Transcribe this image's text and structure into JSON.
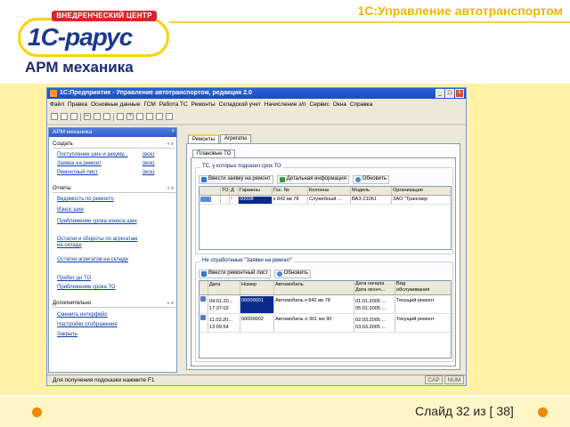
{
  "slide": {
    "logo_banner": "ВНЕДРЕНЧЕСКИЙ ЦЕНТР",
    "logo_word": "1С-рарус",
    "product_title": "1С:Управление автотранспортом",
    "heading": "АРМ механика",
    "slide_number": "Слайд 32 из [ 38]",
    "accent_color": "#f08a00"
  },
  "window": {
    "title": "1С:Предприятие - Управление автотранспортом, редакция 2.0",
    "menu": [
      "Файл",
      "Правка",
      "Основные данные",
      "ГСМ",
      "Работа ТС",
      "Ремонты",
      "Складской учет",
      "Начисление з/п",
      "Сервис",
      "Окна",
      "Справка"
    ],
    "statusbar": {
      "hint": "Для получения подсказки нажмите F1",
      "cap": "CAP",
      "num": "NUM"
    }
  },
  "left_panel": {
    "title": "АРМ механика",
    "sections": [
      {
        "title": "Создать",
        "items": [
          {
            "label": "Поступление шин и аккуму...",
            "all": "(все)"
          },
          {
            "label": "Заявка на ремонт",
            "all": "(все)"
          },
          {
            "label": "Ремонтный лист",
            "all": "(все)"
          }
        ]
      },
      {
        "title": "Отчеты",
        "items": [
          {
            "label": "Ведомость по ремонту"
          },
          {
            "label": "Износ шин"
          },
          {
            "label": "Приближение срока износа шин"
          },
          {
            "label": "Остатки и обороты по агрегатам на складе"
          },
          {
            "label": "Остатки агрегатов на складе"
          },
          {
            "label": "Пробег до ТО"
          },
          {
            "label": "Приближение срока ТО"
          }
        ]
      },
      {
        "title": "Дополнительно",
        "items": [
          {
            "label": "Сменить интерфейс"
          },
          {
            "label": "Настройки отображения"
          },
          {
            "label": "Закрыть"
          }
        ]
      }
    ]
  },
  "main": {
    "tabs": [
      "Ремонты",
      "Агрегаты"
    ],
    "subtab": "Плановые ТО",
    "group1": {
      "caption": "ТС, у которых подошел срок ТО",
      "buttons": [
        "Ввести заявку на ремонт",
        "Детальная информация",
        "Обновить"
      ],
      "columns": [
        "ТО",
        "Д",
        "Гаражны",
        "Гос. №",
        "Колонна",
        "Модель",
        "Организация"
      ],
      "rows": [
        [
          "",
          "",
          "00008",
          "к 842 вв 78",
          "Служебный ...",
          "ВАЗ-21061",
          "ЗАО \"Трансвер"
        ]
      ]
    },
    "group2": {
      "caption": "Не отработаные \"Заявки на ремонт\"",
      "buttons": [
        "Ввести ремонтный лист",
        "Обновить"
      ],
      "columns": [
        "Дата",
        "Номер",
        "Автомобиль",
        "Дата начала",
        "Вид"
      ],
      "columns_sub": [
        "",
        "",
        "",
        "Дата оконч...",
        "обслуживания"
      ],
      "rows": [
        {
          "date1": "04.01.20...",
          "date2": "17:37:02",
          "number": "00000001",
          "car": "Автомобиль к 842 вв 78",
          "start": "01.01.2005 ...",
          "end": "05.01.2005 ...",
          "kind": "Текущий ремонт"
        },
        {
          "date1": "11.03.20...",
          "date2": "13:09:54",
          "number": "00000002",
          "car": "Автомобиль о 301 мн 90",
          "start": "02.03.2005 ...",
          "end": "03.03.2005 ...",
          "kind": "Текущий ремонт"
        }
      ]
    }
  }
}
